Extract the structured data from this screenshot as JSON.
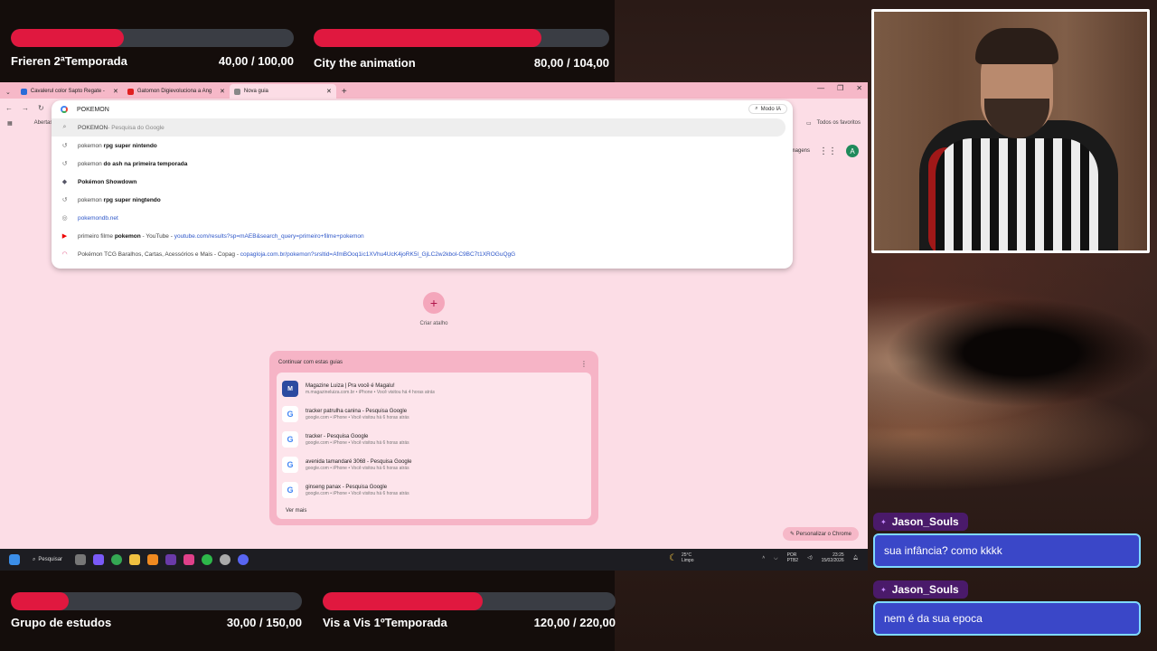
{
  "goals": [
    {
      "title": "Frieren 2ªTemporada",
      "value": "40,00 / 100,00",
      "progress": 0.4
    },
    {
      "title": "City the animation",
      "value": "80,00 / 104,00",
      "progress": 0.77
    },
    {
      "title": "Grupo de estudos",
      "value": "30,00 / 150,00",
      "progress": 0.2
    },
    {
      "title": "Vis a Vis 1ºTemporada",
      "value": "120,00 / 220,00",
      "progress": 0.545
    }
  ],
  "browser": {
    "tabs": [
      {
        "label": "Cavalerul color Sapto Regate -",
        "icon_color": "#2b6cd8",
        "active": false
      },
      {
        "label": "Gatomon Digievoluciona a Ang",
        "icon_color": "#e02020",
        "active": false
      },
      {
        "label": "Nova guia",
        "icon_color": "#888888",
        "active": true
      }
    ],
    "new_tab_icon": "plus-icon",
    "bookmarks_left": "Abertas",
    "bookmarks_right": "Todos os favoritos",
    "images_link": "Imagens",
    "avatar_letter": "A",
    "omnibox": {
      "query": "POKEMON",
      "modo_ia": "Modo IA",
      "suggestions": [
        {
          "pre": "POKEMON",
          "bold": "",
          "post": "",
          "muted": "- Pesquisa do Google",
          "url": "",
          "icon": "search-icon"
        },
        {
          "pre": "pokemon ",
          "bold": "rpg super nintendo",
          "post": "",
          "muted": "",
          "url": "",
          "icon": "history-icon"
        },
        {
          "pre": "pokemon ",
          "bold": "do ash na primeira temporada",
          "post": "",
          "muted": "",
          "url": "",
          "icon": "history-icon"
        },
        {
          "pre": "",
          "bold": "Pokémon Showdown",
          "post": "",
          "muted": "",
          "url": "",
          "icon": "showdown-icon"
        },
        {
          "pre": "pokemon ",
          "bold": "rpg super ningtendo",
          "post": "",
          "muted": "",
          "url": "",
          "icon": "history-icon"
        },
        {
          "pre": "",
          "bold": "",
          "post": "",
          "muted": "",
          "url": "pokemondb.net",
          "icon": "globe-icon"
        },
        {
          "pre": "primeiro filme ",
          "bold": "pokemon",
          "post": " - YouTube - ",
          "muted": "",
          "url": "youtube.com/results?sp=mAEB&search_query=primeiro+filme+pokemon",
          "icon": "youtube-icon"
        },
        {
          "pre": "Pokémon TCG Baralhos, Cartas, Acessórios e Mais - Copag - ",
          "bold": "",
          "post": "",
          "muted": "",
          "url": "copagloja.com.br/pokemon?srsltid=AfmBOoq1ic1XVhu4UcK4joRK5l_GjLC2w2kbol-C9BC7t1XROGuQgG",
          "icon": "copag-icon"
        }
      ]
    },
    "create_shortcut": "Criar atalho",
    "continue": {
      "title": "Continuar com estas guias",
      "items": [
        {
          "title": "Magazine Luiza | Pra você é Magalu!",
          "sub": "m.magazineluiza.com.br • iPhone • Você visitou há 4 horas atrás",
          "icon": "M"
        },
        {
          "title": "tracker patrulha canina - Pesquisa Google",
          "sub": "google.com • iPhone • Você visitou há 6 horas atrás",
          "icon": "G"
        },
        {
          "title": "tracker - Pesquisa Google",
          "sub": "google.com • iPhone • Você visitou há 6 horas atrás",
          "icon": "G"
        },
        {
          "title": "avenida tamandaré 3068 - Pesquisa Google",
          "sub": "google.com • iPhone • Você visitou há 6 horas atrás",
          "icon": "G"
        },
        {
          "title": "ginseng panax - Pesquisa Google",
          "sub": "google.com • iPhone • Você visitou há 6 horas atrás",
          "icon": "G"
        }
      ],
      "more": "Ver mais"
    },
    "personalize": "Personalizar o Chrome"
  },
  "taskbar": {
    "search": "Pesquisar",
    "weather_temp": "25°C",
    "weather_desc": "Limpo",
    "lang": "POR",
    "kb": "PTB2",
    "time": "23:25",
    "date": "15/02/2026"
  },
  "chat": [
    {
      "user": "Jason_Souls",
      "message": "sua infância? como kkkk"
    },
    {
      "user": "Jason_Souls",
      "message": "nem é da sua epoca"
    }
  ]
}
